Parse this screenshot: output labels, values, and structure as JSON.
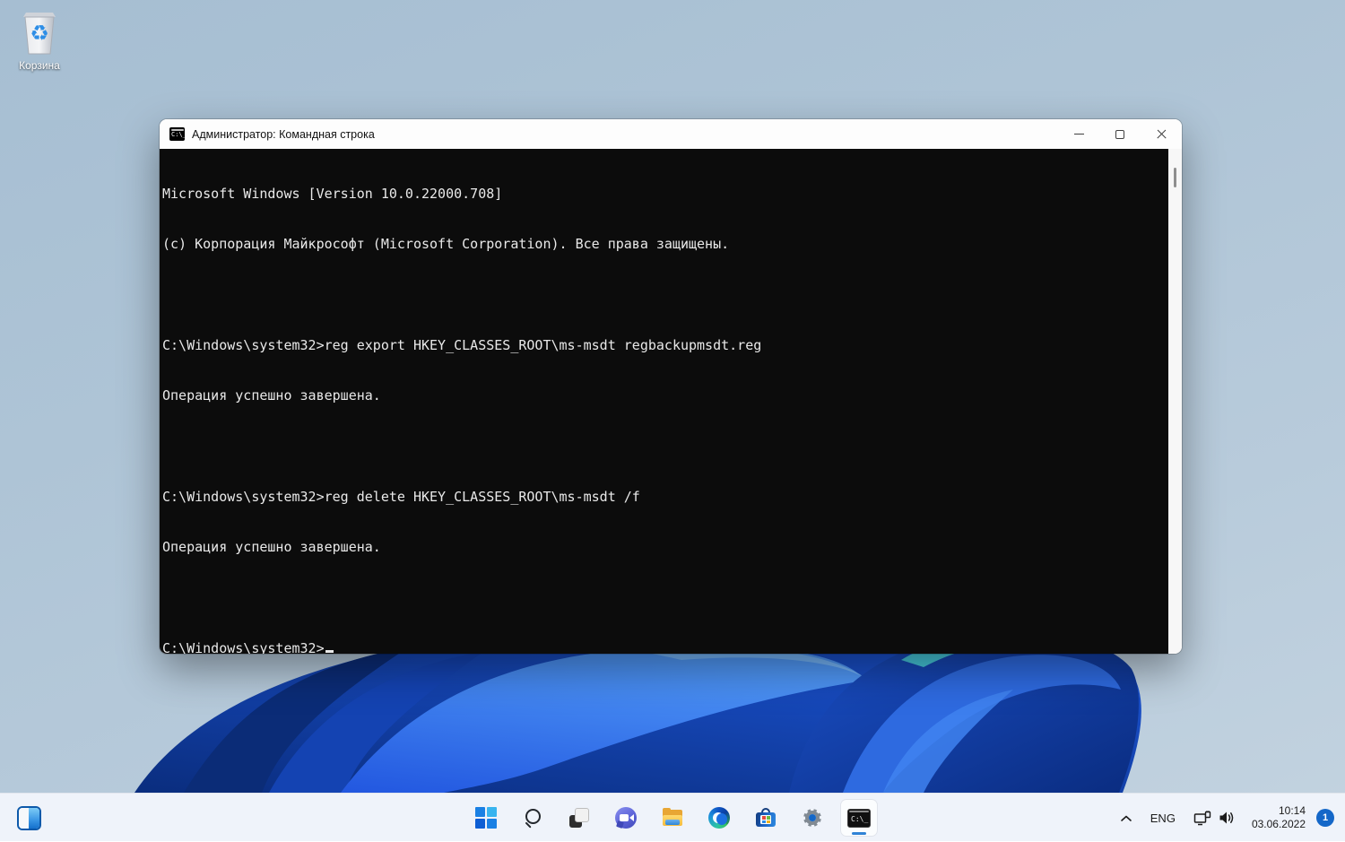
{
  "colors": {
    "wallpaper_base": "#aec4d6",
    "console_bg": "#0c0c0c",
    "console_text": "#e9e9e9",
    "taskbar_bg": "#eff3fa",
    "accent_blue": "#2f83d6",
    "badge_blue": "#1467c8"
  },
  "desktop": {
    "recycle_bin_label": "Корзина",
    "recycle_symbol": "♻"
  },
  "window": {
    "title": "Администратор: Командная строка",
    "cmd_icon_text": "C:\\_",
    "controls": [
      "minimize",
      "maximize",
      "close"
    ],
    "console_lines": [
      "Microsoft Windows [Version 10.0.22000.708]",
      "(c) Корпорация Майкрософт (Microsoft Corporation). Все права защищены.",
      "",
      "C:\\Windows\\system32>reg export HKEY_CLASSES_ROOT\\ms-msdt regbackupmsdt.reg",
      "Операция успешно завершена.",
      "",
      "C:\\Windows\\system32>reg delete HKEY_CLASSES_ROOT\\ms-msdt /f",
      "Операция успешно завершена.",
      "",
      "C:\\Windows\\system32>"
    ]
  },
  "taskbar": {
    "icons": [
      "windows-start",
      "search",
      "task-view",
      "chat",
      "file-explorer",
      "edge",
      "microsoft-store",
      "settings",
      "command-prompt"
    ],
    "active_icon": "command-prompt",
    "tray": {
      "language": "ENG",
      "time": "10:14",
      "date": "03.06.2022",
      "notification_count": "1"
    }
  }
}
